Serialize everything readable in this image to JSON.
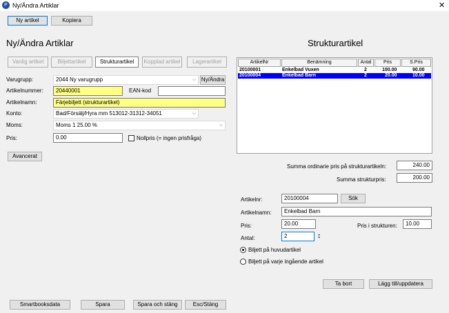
{
  "window": {
    "title": "Ny/Ändra Artiklar",
    "close": "✕",
    "app_icon": "P"
  },
  "toolbar": {
    "new_article": "Ny artikel",
    "copy": "Kopiera"
  },
  "left": {
    "heading": "Ny/Ändra Artiklar",
    "tabs": [
      "Vanlig artikel",
      "Biljettartikel",
      "Strukturartikel",
      "Kopplad artikel",
      "Lagerartikel"
    ],
    "varugrupp_label": "Varugrupp:",
    "varugrupp_value": "2044 Ny varugrupp",
    "ny_andra": "Ny/Ändra",
    "artikelnummer_label": "Artikelnummer:",
    "artikelnummer_value": "20440001",
    "ean_label": "EAN-kod",
    "ean_value": "",
    "artikelnamn_label": "Artikelnamn:",
    "artikelnamn_value": "Färjebiljett (strukturartikel)",
    "konto_label": "Konto:",
    "konto_value": "Bad/Försälj/Hyra mm 513012-31312-34051",
    "moms_label": "Moms:",
    "moms_value": "Moms 1 25.00 %",
    "pris_label": "Pris:",
    "pris_value": "0.00",
    "nollpris_label": "Nollpris (= ingen prisfråga)",
    "avancerat": "Avancerat"
  },
  "right": {
    "heading": "Strukturartikel",
    "columns": [
      "ArtikelNr",
      "Benämning",
      "Antal",
      "Pris",
      "S.Pris"
    ],
    "rows": [
      {
        "nr": "20100001",
        "name": "Enkelbad Vuxen",
        "antal": "2",
        "pris": "100.00",
        "spris": "90.00"
      },
      {
        "nr": "20100004",
        "name": "Enkelbad Barn",
        "antal": "2",
        "pris": "20.00",
        "spris": "10.00"
      }
    ],
    "summa_ordinarie_label": "Summa ordinarie pris på strukturartikeln:",
    "summa_ordinarie_value": "240.00",
    "summa_struktur_label": "Summa strukturpris:",
    "summa_struktur_value": "200.00",
    "artikelnr_label": "Artikelnr:",
    "artikelnr_value": "20100004",
    "sok": "Sök",
    "artikelnamn_label": "Artikelnamn:",
    "artikelnamn_value": "Enkelbad Barn",
    "pris_label": "Pris:",
    "pris_value": "20.00",
    "pris_struktur_label": "Pris i strukturen:",
    "pris_struktur_value": "10.00",
    "antal_label": "Antal:",
    "antal_value": "2",
    "radio_huvud": "Biljett på huvudartikel",
    "radio_varje": "Biljett på varje ingående artikel",
    "ta_bort": "Ta bort",
    "lagg_till": "Lägg till/uppdatera"
  },
  "footer": {
    "smartbooksdata": "Smartbooksdata",
    "spara": "Spara",
    "spara_stang": "Spara och stäng",
    "esc": "Esc/Stäng"
  }
}
